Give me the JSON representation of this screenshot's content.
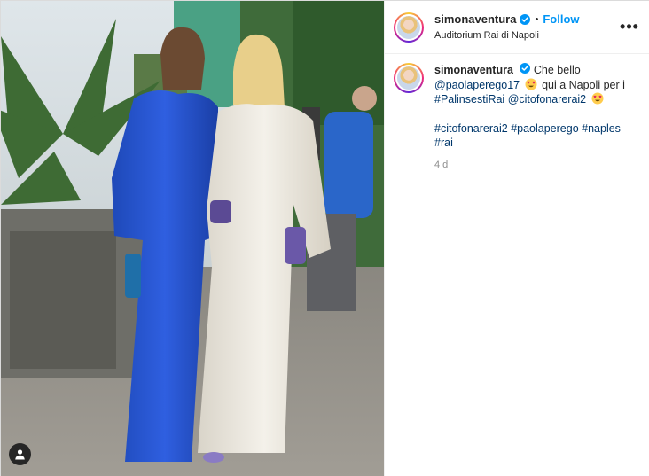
{
  "post": {
    "username": "simonaventura",
    "separator": "•",
    "follow_label": "Follow",
    "location": "Auditorium Rai di Napoli",
    "more_label": "•••"
  },
  "caption": {
    "username": "simonaventura",
    "text_1": "Che bello",
    "mention_1": "@paolaperego17",
    "text_2": "qui a Napoli per",
    "text_3": "i",
    "hashtag_1": "#PalinsestiRai",
    "mention_2": "@citofonarerai2",
    "hashtags": [
      "#citofonarerai2",
      "#paolaperego",
      "#naples",
      "#rai"
    ],
    "timestamp": "4 d"
  },
  "icons": {
    "verified": "verified-badge-icon",
    "more": "more-options-icon",
    "user_tag": "user-tag-icon",
    "emoji": "heart-eyes-emoji"
  },
  "colors": {
    "accent": "#0095f6",
    "link": "#00376b",
    "muted": "#8e8e8e"
  }
}
